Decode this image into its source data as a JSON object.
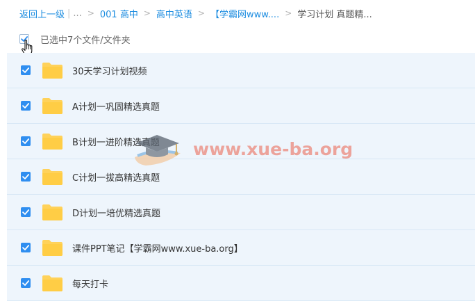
{
  "breadcrumb": {
    "back": "返回上一级",
    "ellipsis": "...",
    "items": [
      "001 高中",
      "高中英语",
      "【学霸网www....",
      "学习计划 真题精..."
    ]
  },
  "selection": {
    "text": "已选中7个文件/文件夹"
  },
  "files": [
    {
      "name": "30天学习计划视频"
    },
    {
      "name": "A计划一巩固精选真题"
    },
    {
      "name": "B计划一进阶精选真题"
    },
    {
      "name": "C计划一拔高精选真题"
    },
    {
      "name": "D计划一培优精选真题"
    },
    {
      "name": "课件PPT笔记【学霸网www.xue-ba.org】"
    },
    {
      "name": "每天打卡"
    }
  ],
  "watermark": {
    "text": "www.xue-ba.org"
  },
  "colors": {
    "link": "#1d8de0",
    "checkbox": "#2f8ef0",
    "row_bg": "#eef5fc",
    "folder": "#ffd25a",
    "watermark": "#eb5f4b"
  },
  "icons": {
    "checkbox": "check-icon",
    "folder": "folder-icon",
    "cursor": "hand-cursor-icon",
    "watermark_logo": "graduation-cap-icon"
  }
}
